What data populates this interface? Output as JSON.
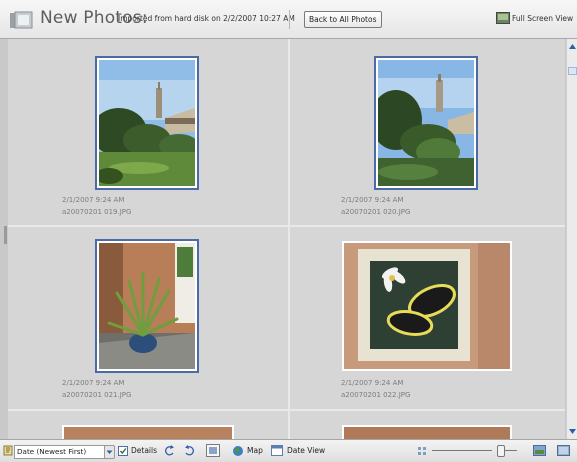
{
  "header": {
    "title": "New Photos:",
    "subtitle": "Imported from hard disk on 2/2/2007 10:27 AM",
    "back_label": "Back to All Photos",
    "fullscreen_label": "Full Screen View"
  },
  "photos": [
    {
      "date": "2/1/2007 9:24 AM",
      "filename": "a20070201 019.JPG",
      "selected": true
    },
    {
      "date": "2/1/2007 9:24 AM",
      "filename": "a20070201 020.JPG",
      "selected": true
    },
    {
      "date": "2/1/2007 9:24 AM",
      "filename": "a20070201 021.JPG",
      "selected": true
    },
    {
      "date": "2/1/2007 9:24 AM",
      "filename": "a20070201 022.JPG",
      "selected": false
    }
  ],
  "toolbar": {
    "sort_value": "Date (Newest First)",
    "details_label": "Details",
    "map_label": "Map",
    "date_view_label": "Date View",
    "details_checked": true
  },
  "colors": {
    "accent": "#4a6aa8",
    "grid_bg": "#d6d6d6"
  }
}
